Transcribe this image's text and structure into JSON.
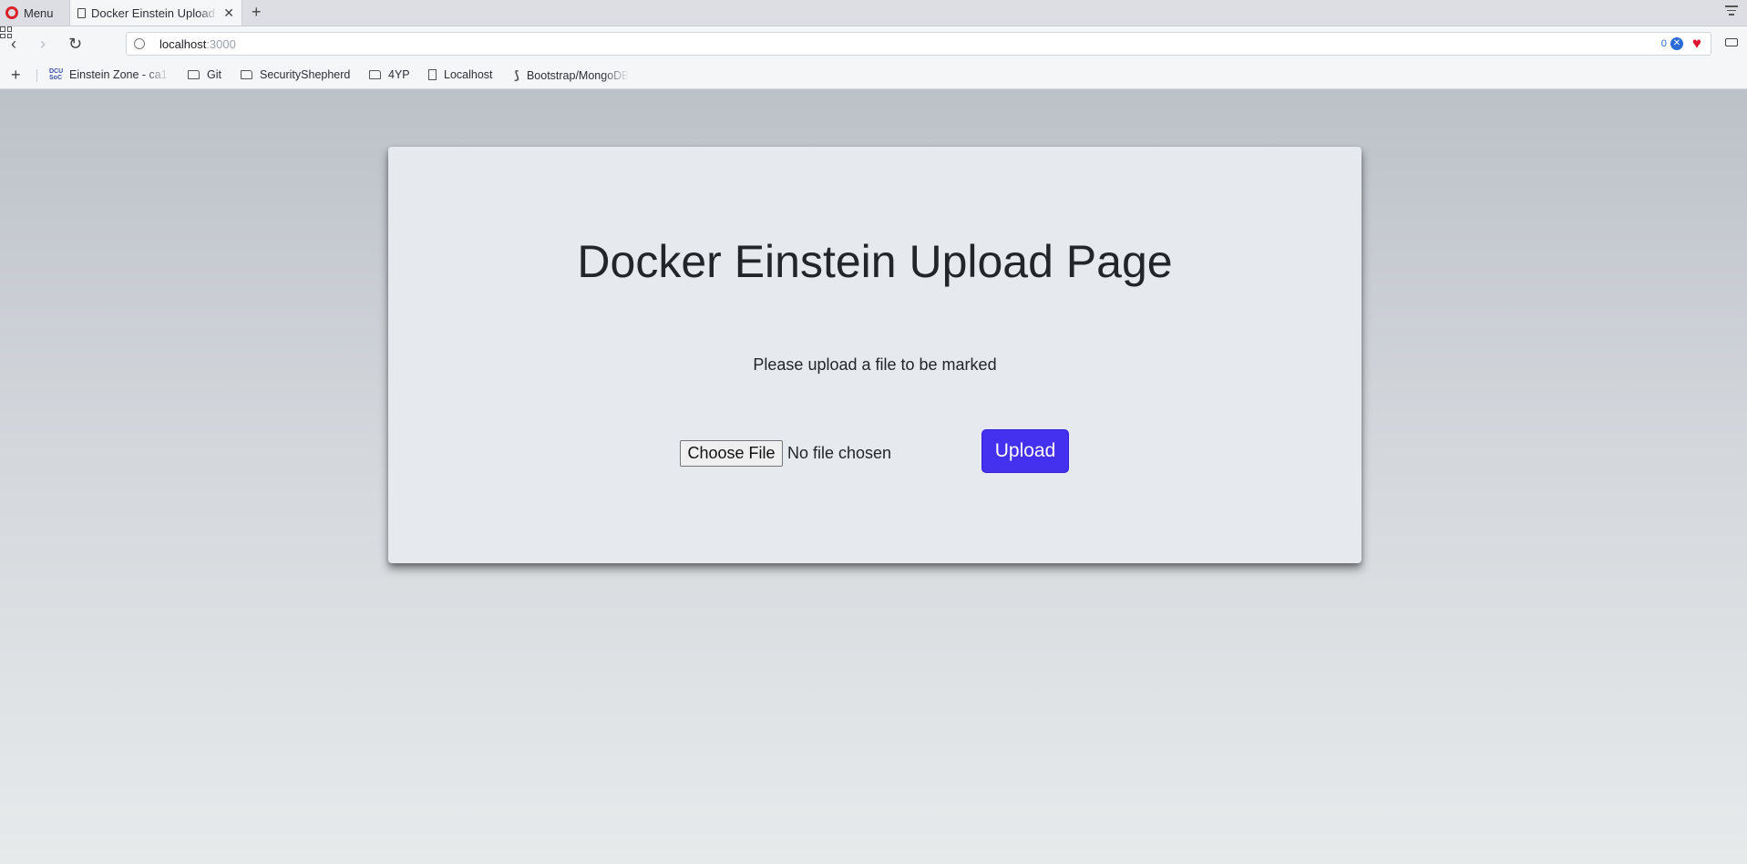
{
  "browser": {
    "menu_label": "Menu",
    "tab_title": "Docker Einstein Upload Page",
    "url_host": "localhost",
    "url_port": ":3000",
    "blocked_count": "0"
  },
  "bookmarks": [
    {
      "label": "Einstein Zone - ca1",
      "icon": "dcu-icon"
    },
    {
      "label": "Git",
      "icon": "folder-icon"
    },
    {
      "label": "SecurityShepherd",
      "icon": "folder-icon"
    },
    {
      "label": "4YP",
      "icon": "folder-icon"
    },
    {
      "label": "Localhost",
      "icon": "page-icon"
    },
    {
      "label": "Bootstrap/MongoDB",
      "icon": "bootstrap-icon"
    }
  ],
  "page": {
    "title": "Docker Einstein Upload Page",
    "prompt": "Please upload a file to be marked",
    "choose_file_label": "Choose File",
    "file_status": "No file chosen",
    "upload_label": "Upload"
  },
  "colors": {
    "upload_button": "#4431f0",
    "card_background": "#e6e9ee",
    "heart": "#e0122f",
    "shield": "#2b6cd8"
  }
}
